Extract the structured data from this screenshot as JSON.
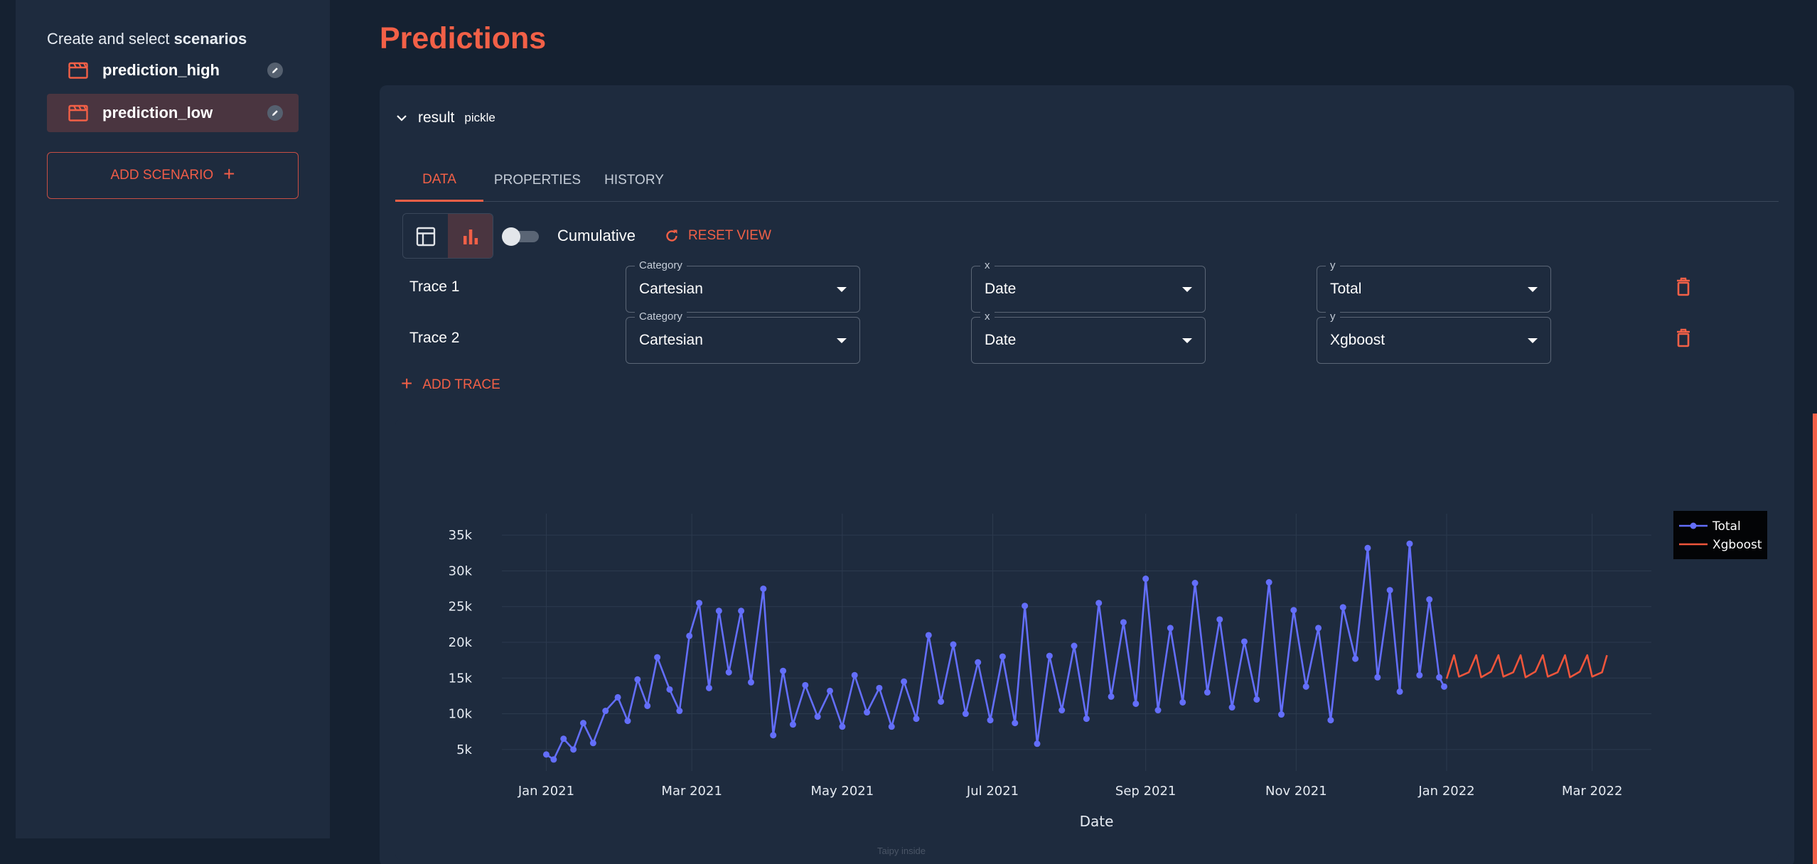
{
  "sidebar": {
    "title_prefix": "Create and select",
    "title_bold": "scenarios",
    "scenarios": [
      {
        "name": "prediction_high",
        "icon": "clapperboard-icon",
        "selected": false
      },
      {
        "name": "prediction_low",
        "icon": "clapperboard-icon",
        "selected": true
      }
    ],
    "add_scenario_label": "ADD SCENARIO"
  },
  "main": {
    "title": "Predictions",
    "result": {
      "name": "result",
      "type": "pickle"
    },
    "tabs": [
      {
        "label": "DATA",
        "active": true
      },
      {
        "label": "PROPERTIES",
        "active": false
      },
      {
        "label": "HISTORY",
        "active": false
      }
    ],
    "toolbar": {
      "cumulative_label": "Cumulative",
      "cumulative_on": false,
      "reset_label": "RESET VIEW",
      "view_mode": "chart"
    },
    "traces": [
      {
        "label": "Trace 1",
        "category_label": "Category",
        "category": "Cartesian",
        "x_label": "x",
        "x": "Date",
        "y_label": "y",
        "y": "Total"
      },
      {
        "label": "Trace 2",
        "category_label": "Category",
        "category": "Cartesian",
        "x_label": "x",
        "x": "Date",
        "y_label": "y",
        "y": "Xgboost"
      }
    ],
    "add_trace_label": "ADD TRACE",
    "watermark": "Taipy inside"
  },
  "colors": {
    "accent": "#f26047",
    "total": "#636efa",
    "xgboost": "#ef553b"
  },
  "chart_data": {
    "type": "line",
    "xlabel": "Date",
    "ylabel": "",
    "x_tick_labels": [
      "Jan 2021",
      "Mar 2021",
      "May 2021",
      "Jul 2021",
      "Sep 2021",
      "Nov 2021",
      "Jan 2022",
      "Mar 2022"
    ],
    "x_range": [
      "2020-12-14",
      "2022-03-25"
    ],
    "y_tick_labels": [
      "5k",
      "10k",
      "15k",
      "20k",
      "25k",
      "30k",
      "35k"
    ],
    "ylim": [
      2000,
      38000
    ],
    "legend_position": "top-right",
    "grid": true,
    "series": [
      {
        "name": "Total",
        "mode": "lines+markers",
        "color": "#636efa",
        "points": [
          [
            "2021-01-01",
            4300
          ],
          [
            "2021-01-04",
            3600
          ],
          [
            "2021-01-08",
            6500
          ],
          [
            "2021-01-12",
            5000
          ],
          [
            "2021-01-16",
            8700
          ],
          [
            "2021-01-20",
            5900
          ],
          [
            "2021-01-25",
            10400
          ],
          [
            "2021-01-30",
            12300
          ],
          [
            "2021-02-03",
            9000
          ],
          [
            "2021-02-07",
            14800
          ],
          [
            "2021-02-11",
            11100
          ],
          [
            "2021-02-15",
            17900
          ],
          [
            "2021-02-20",
            13400
          ],
          [
            "2021-02-24",
            10400
          ],
          [
            "2021-02-28",
            20900
          ],
          [
            "2021-03-04",
            25500
          ],
          [
            "2021-03-08",
            13600
          ],
          [
            "2021-03-12",
            24400
          ],
          [
            "2021-03-16",
            15800
          ],
          [
            "2021-03-21",
            24400
          ],
          [
            "2021-03-25",
            14400
          ],
          [
            "2021-03-30",
            27500
          ],
          [
            "2021-04-03",
            7000
          ],
          [
            "2021-04-07",
            16000
          ],
          [
            "2021-04-11",
            8500
          ],
          [
            "2021-04-16",
            14000
          ],
          [
            "2021-04-21",
            9600
          ],
          [
            "2021-04-26",
            13200
          ],
          [
            "2021-05-01",
            8200
          ],
          [
            "2021-05-06",
            15400
          ],
          [
            "2021-05-11",
            10200
          ],
          [
            "2021-05-16",
            13600
          ],
          [
            "2021-05-21",
            8200
          ],
          [
            "2021-05-26",
            14500
          ],
          [
            "2021-05-31",
            9300
          ],
          [
            "2021-06-05",
            21000
          ],
          [
            "2021-06-10",
            11700
          ],
          [
            "2021-06-15",
            19700
          ],
          [
            "2021-06-20",
            10000
          ],
          [
            "2021-06-25",
            17200
          ],
          [
            "2021-06-30",
            9100
          ],
          [
            "2021-07-05",
            18000
          ],
          [
            "2021-07-10",
            8700
          ],
          [
            "2021-07-14",
            25100
          ],
          [
            "2021-07-19",
            5800
          ],
          [
            "2021-07-24",
            18100
          ],
          [
            "2021-07-29",
            10500
          ],
          [
            "2021-08-03",
            19500
          ],
          [
            "2021-08-08",
            9300
          ],
          [
            "2021-08-13",
            25500
          ],
          [
            "2021-08-18",
            12400
          ],
          [
            "2021-08-23",
            22800
          ],
          [
            "2021-08-28",
            11400
          ],
          [
            "2021-09-01",
            28900
          ],
          [
            "2021-09-06",
            10500
          ],
          [
            "2021-09-11",
            22000
          ],
          [
            "2021-09-16",
            11600
          ],
          [
            "2021-09-21",
            28300
          ],
          [
            "2021-09-26",
            13000
          ],
          [
            "2021-10-01",
            23200
          ],
          [
            "2021-10-06",
            10900
          ],
          [
            "2021-10-11",
            20100
          ],
          [
            "2021-10-16",
            12000
          ],
          [
            "2021-10-21",
            28400
          ],
          [
            "2021-10-26",
            9900
          ],
          [
            "2021-10-31",
            24500
          ],
          [
            "2021-11-05",
            13800
          ],
          [
            "2021-11-10",
            22000
          ],
          [
            "2021-11-15",
            9100
          ],
          [
            "2021-11-20",
            24900
          ],
          [
            "2021-11-25",
            17700
          ],
          [
            "2021-11-30",
            33200
          ],
          [
            "2021-12-04",
            15100
          ],
          [
            "2021-12-09",
            27300
          ],
          [
            "2021-12-13",
            13100
          ],
          [
            "2021-12-17",
            33800
          ],
          [
            "2021-12-21",
            15400
          ],
          [
            "2021-12-25",
            26000
          ],
          [
            "2021-12-29",
            15100
          ],
          [
            "2021-12-31",
            13800
          ]
        ]
      },
      {
        "name": "Xgboost",
        "mode": "lines",
        "color": "#ef553b",
        "points": [
          [
            "2022-01-01",
            14900
          ],
          [
            "2022-01-04",
            18200
          ],
          [
            "2022-01-06",
            15200
          ],
          [
            "2022-01-10",
            15800
          ],
          [
            "2022-01-13",
            18200
          ],
          [
            "2022-01-15",
            15100
          ],
          [
            "2022-01-19",
            15900
          ],
          [
            "2022-01-22",
            18200
          ],
          [
            "2022-01-24",
            15200
          ],
          [
            "2022-01-28",
            15800
          ],
          [
            "2022-01-31",
            18200
          ],
          [
            "2022-02-02",
            15100
          ],
          [
            "2022-02-06",
            15900
          ],
          [
            "2022-02-09",
            18200
          ],
          [
            "2022-02-11",
            15200
          ],
          [
            "2022-02-15",
            15800
          ],
          [
            "2022-02-18",
            18200
          ],
          [
            "2022-02-20",
            15100
          ],
          [
            "2022-02-24",
            15900
          ],
          [
            "2022-02-27",
            18200
          ],
          [
            "2022-03-01",
            15200
          ],
          [
            "2022-03-05",
            15800
          ],
          [
            "2022-03-07",
            18200
          ]
        ]
      }
    ]
  }
}
